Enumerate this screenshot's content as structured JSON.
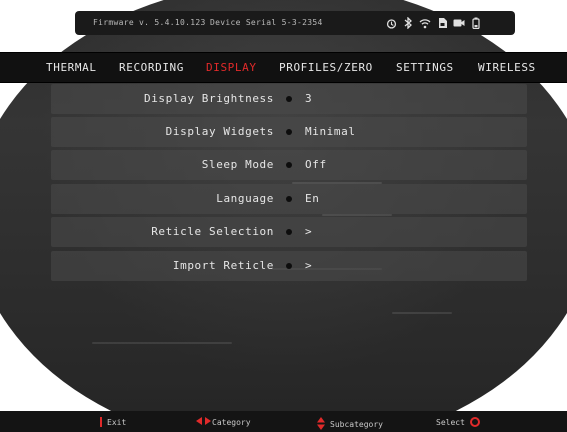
{
  "status_bar": {
    "firmware": "Firmware v. 5.4.10.123",
    "device_serial": "Device Serial 5-3-2354",
    "icons": [
      "timer-icon",
      "bluetooth-icon",
      "wifi-icon",
      "sd-card-icon",
      "video-record-icon",
      "battery-icon"
    ]
  },
  "nav": {
    "tabs": [
      {
        "label": "THERMAL",
        "active": false
      },
      {
        "label": "RECORDING",
        "active": false
      },
      {
        "label": "DISPLAY",
        "active": true
      },
      {
        "label": "PROFILES/ZERO",
        "active": false
      },
      {
        "label": "SETTINGS",
        "active": false
      },
      {
        "label": "WIRELESS",
        "active": false
      }
    ]
  },
  "menu": {
    "rows": [
      {
        "label": "Display Brightness",
        "value": "3"
      },
      {
        "label": "Display Widgets",
        "value": "Minimal"
      },
      {
        "label": "Sleep Mode",
        "value": "Off"
      },
      {
        "label": "Language",
        "value": "En"
      },
      {
        "label": "Reticle Selection",
        "value": ">"
      },
      {
        "label": "Import Reticle",
        "value": ">"
      }
    ]
  },
  "footer": {
    "exit": "Exit",
    "category": "Category",
    "subcategory": "Subcategory",
    "select": "Select"
  },
  "colors": {
    "accent": "#e12a2a",
    "text": "#e6e6e6",
    "bar": "#111111"
  }
}
